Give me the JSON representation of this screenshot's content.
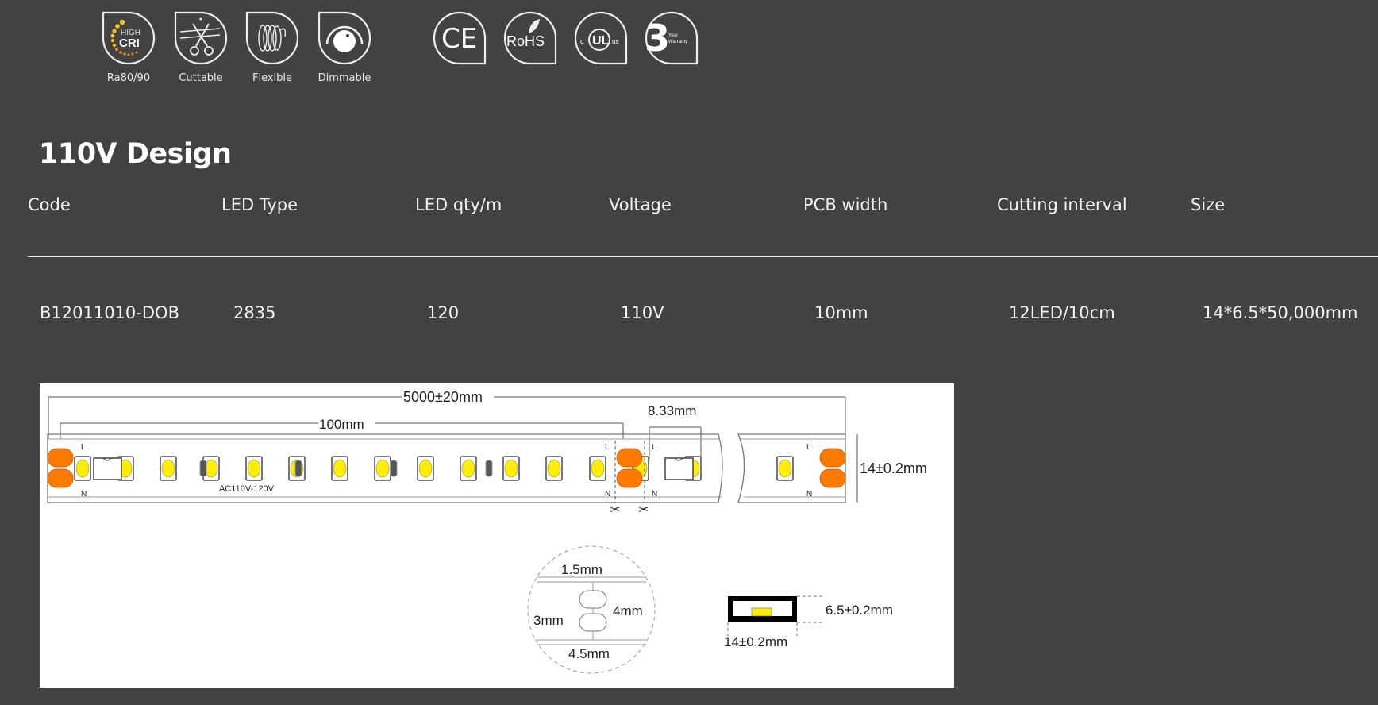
{
  "feature_badges": [
    {
      "icon": "high-cri-icon",
      "label": "Ra80/90",
      "icon_text_top": "HIGH",
      "icon_text_main": "CRI"
    },
    {
      "icon": "scissors-icon",
      "label": "Cuttable"
    },
    {
      "icon": "flexible-coil-icon",
      "label": "Flexible"
    },
    {
      "icon": "dimmer-knob-icon",
      "label": "Dimmable"
    }
  ],
  "certifications": [
    {
      "icon": "ce-icon",
      "text": "CE"
    },
    {
      "icon": "rohs-icon",
      "text": "RoHS"
    },
    {
      "icon": "ul-icon",
      "text": "UL",
      "prefix": "c",
      "suffix": "us"
    },
    {
      "icon": "warranty-icon",
      "text": "3",
      "sub": "Year Warranty"
    }
  ],
  "section": {
    "title": "110V Design"
  },
  "table": {
    "headers": [
      "Code",
      "LED Type",
      "LED qty/m",
      "Voltage",
      "PCB width",
      "Cutting interval",
      "Size"
    ],
    "rows": [
      [
        "B12011010-DOB",
        "2835",
        "120",
        "110V",
        "10mm",
        "12LED/10cm",
        "14*6.5*50,000mm"
      ]
    ]
  },
  "diagram": {
    "total_length": "5000±20mm",
    "segment_length": "100mm",
    "pitch": "8.33mm",
    "strip_width": "14±0.2mm",
    "voltage_label": "AC110V-120V",
    "pad_L": "L",
    "pad_N": "N",
    "pad_spacing_top": "1.5mm",
    "pad_height": "4mm",
    "pad_gap": "3mm",
    "pad_width": "4.5mm",
    "profile_height": "6.5±0.2mm",
    "profile_width": "14±0.2mm",
    "colors": {
      "led": "#ffee00",
      "pad": "#ff7a00",
      "outline": "#555555"
    }
  }
}
